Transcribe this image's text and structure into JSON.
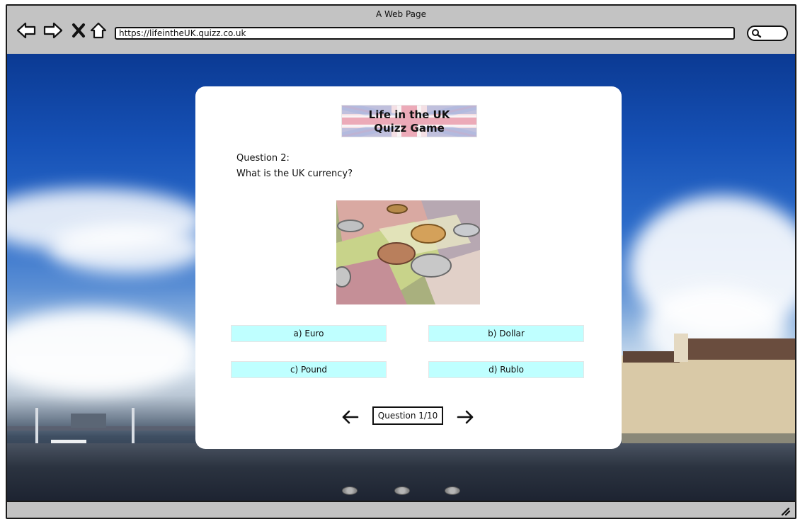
{
  "window": {
    "title": "A Web Page"
  },
  "browser": {
    "address": "https://lifeintheUK.quizz.co.uk",
    "icons": {
      "back": "back-arrow-icon",
      "forward": "forward-arrow-icon",
      "stop": "close-icon",
      "home": "home-icon",
      "search": "search-icon",
      "resize": "resize-grip-icon"
    }
  },
  "quiz": {
    "logo_line1": "Life in the UK",
    "logo_line2": "Quizz Game",
    "question_label": "Question 2:",
    "question_text": "What is the UK currency?",
    "answers": [
      {
        "label": "a) Euro"
      },
      {
        "label": "b) Dollar"
      },
      {
        "label": "c) Pound"
      },
      {
        "label": "d) Rublo"
      }
    ],
    "counter": "Question 1/10"
  },
  "colors": {
    "answer_bg": "#bfffff",
    "chrome": "#c3c3c3",
    "flag_red": "#e8a3b1",
    "flag_blue": "#7f89c4"
  }
}
